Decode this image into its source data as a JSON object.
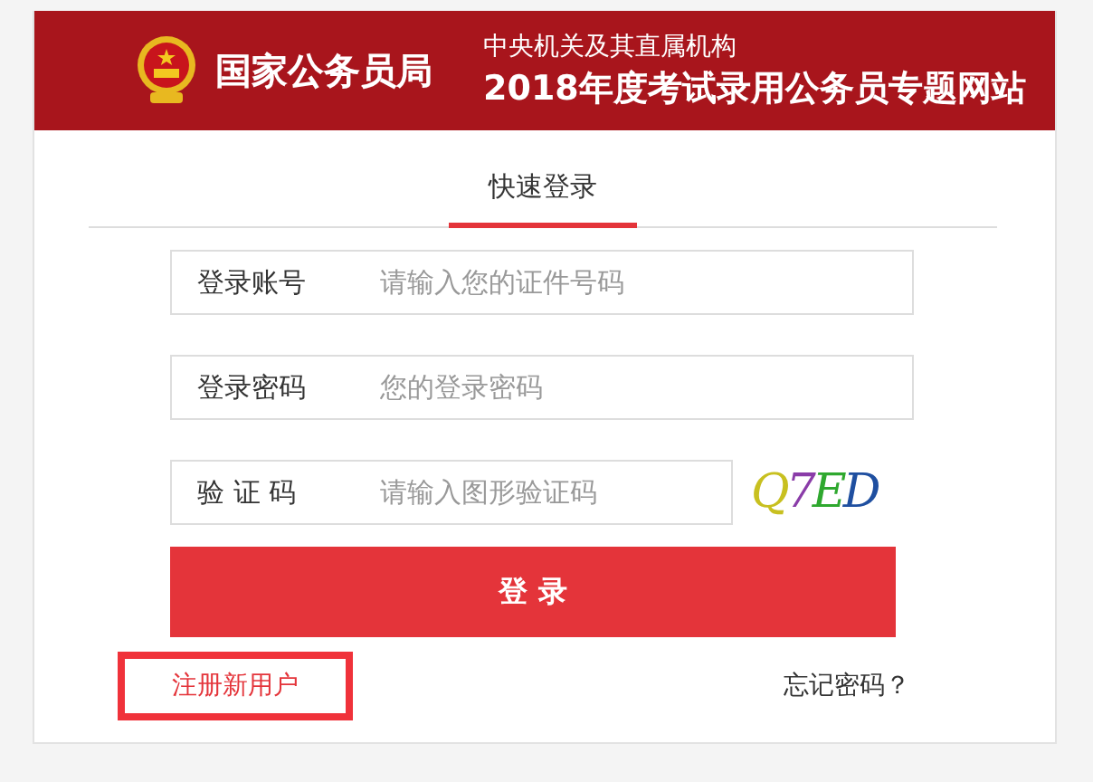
{
  "header": {
    "agency": "国家公务员局",
    "subtitle": "中央机关及其直属机构",
    "title": "2018年度考试录用公务员专题网站"
  },
  "tabs": [
    {
      "label": "快速登录",
      "selected": true
    }
  ],
  "fields": [
    {
      "label": "登录账号",
      "placeholder": "请输入您的证件号码"
    },
    {
      "label": "登录密码",
      "placeholder": "您的登录密码"
    },
    {
      "label": "验 证 码",
      "placeholder": "请输入图形验证码"
    }
  ],
  "captcha": {
    "text": "Q7ED"
  },
  "login_button": "登 录",
  "register_link": {
    "label": "注册新用户",
    "highlighted": true
  },
  "forgot_link": "忘记密码？"
}
